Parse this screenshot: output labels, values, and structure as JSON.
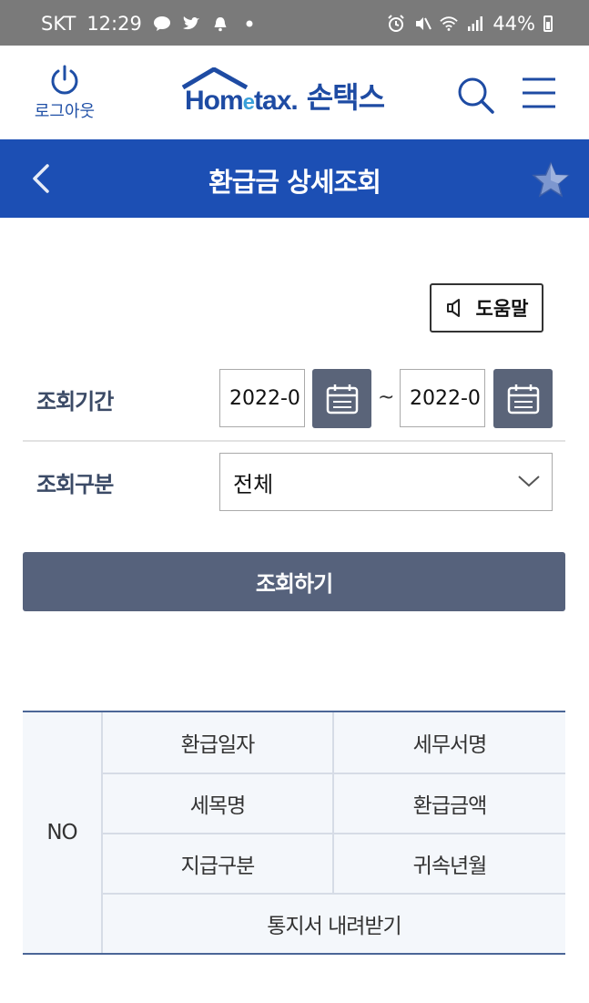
{
  "status_bar": {
    "carrier": "SKT",
    "time": "12:29",
    "battery": "44%"
  },
  "header": {
    "logout_label": "로그아웃",
    "brand_home": "Hom",
    "brand_e": "e",
    "brand_tax": "tax.",
    "brand_korean": "손택스"
  },
  "title_bar": {
    "title": "환급금 상세조회"
  },
  "help": {
    "label": "도움말"
  },
  "form": {
    "period_label": "조회기간",
    "start_date": "2022-0",
    "end_date": "2022-0",
    "range_separator": "~",
    "type_label": "조회구분",
    "type_selected": "전체",
    "search_button": "조회하기"
  },
  "result_table": {
    "no_header": "NO",
    "headers": [
      [
        "환급일자",
        "세무서명"
      ],
      [
        "세목명",
        "환급금액"
      ],
      [
        "지급구분",
        "귀속년월"
      ],
      [
        "통지서 내려받기"
      ]
    ]
  },
  "colors": {
    "primary_blue": "#1c4fb4",
    "button_slate": "#56627c",
    "table_bg": "#f4f7fb"
  }
}
